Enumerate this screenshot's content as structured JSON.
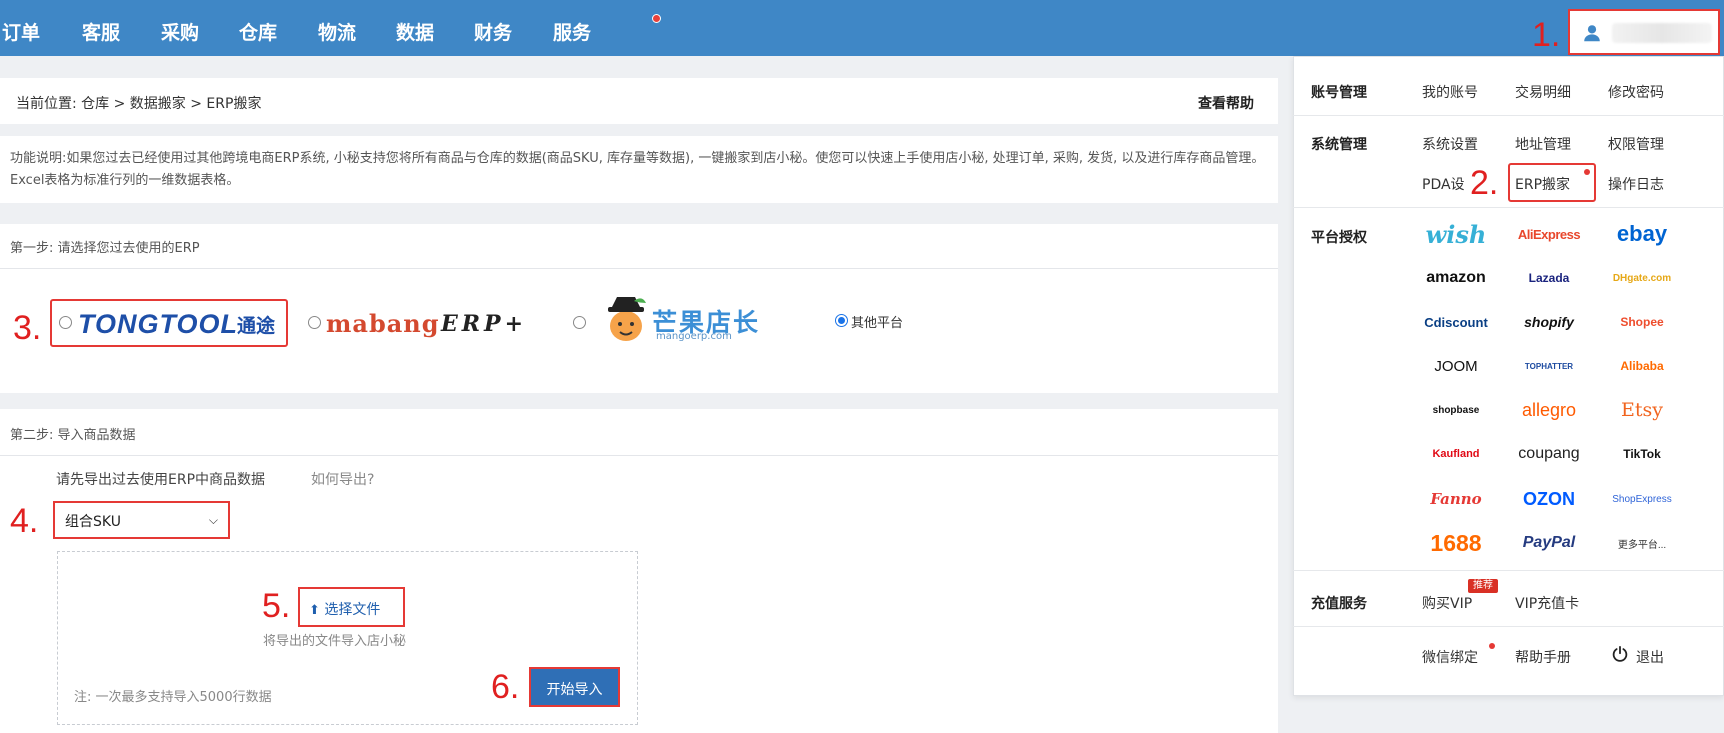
{
  "topnav": {
    "items": [
      "订单",
      "客服",
      "采购",
      "仓库",
      "物流",
      "数据",
      "财务",
      "服务"
    ]
  },
  "annotations": [
    "1.",
    "2.",
    "3.",
    "4.",
    "5.",
    "6."
  ],
  "breadcrumb": {
    "text": "当前位置:  仓库 > 数据搬家 > ERP搬家",
    "help": "查看帮助"
  },
  "description": {
    "text": "功能说明:如果您过去已经使用过其他跨境电商ERP系统, 小秘支持您将所有商品与仓库的数据(商品SKU, 库存量等数据), 一键搬家到店小秘。使您可以快速上手使用店小秘, 处理订单, 采购, 发货, 以及进行库存商品管理。Excel表格为标准行列的一维数据表格。"
  },
  "step1": {
    "title": "第一步: 请选择您过去使用的ERP",
    "options": {
      "tongtool": "TONGTOOL",
      "tongtool_cn": "通途",
      "mabang": "mabang",
      "mabang_erp": "ERP+",
      "mango_cn": "芒果店长",
      "mango_url": "mangoerp.com",
      "other": "其他平台"
    },
    "selected": "其他平台"
  },
  "step2": {
    "title": "第二步: 导入商品数据",
    "hint": "请先导出过去使用ERP中商品数据",
    "how": "如何导出?",
    "select_value": "组合SKU",
    "choose_file": "选择文件",
    "file_hint": "将导出的文件导入店小秘",
    "note": "注: 一次最多支持导入5000行数据",
    "start": "开始导入"
  },
  "menu": {
    "account": {
      "head": "账号管理",
      "items": [
        "我的账号",
        "交易明细",
        "修改密码"
      ]
    },
    "system": {
      "head": "系统管理",
      "items": [
        "系统设置",
        "地址管理",
        "权限管理",
        "PDA设",
        "ERP搬家",
        "操作日志"
      ]
    },
    "platform": {
      "head": "平台授权",
      "items": [
        "wish",
        "AliExpress",
        "ebay",
        "amazon",
        "Lazada",
        "DHgate.com",
        "Cdiscount",
        "shopify",
        "Shopee",
        "JOOM",
        "TOPHATTER",
        "Alibaba",
        "shopbase",
        "allegro",
        "Etsy",
        "Kaufland",
        "coupang",
        "TikTok",
        "Fanno",
        "OZON",
        "ShopExpress",
        "1688",
        "PayPal",
        "更多平台..."
      ]
    },
    "recharge": {
      "head": "充值服务",
      "items": [
        "购买VIP",
        "VIP充值卡"
      ],
      "badge": "推荐"
    },
    "bottom": [
      "微信绑定",
      "帮助手册",
      "退出"
    ]
  },
  "colors": {
    "nav_blue": "#3f87c6",
    "annotation_red": "#e02020",
    "primary_button": "#2f6fb6"
  }
}
